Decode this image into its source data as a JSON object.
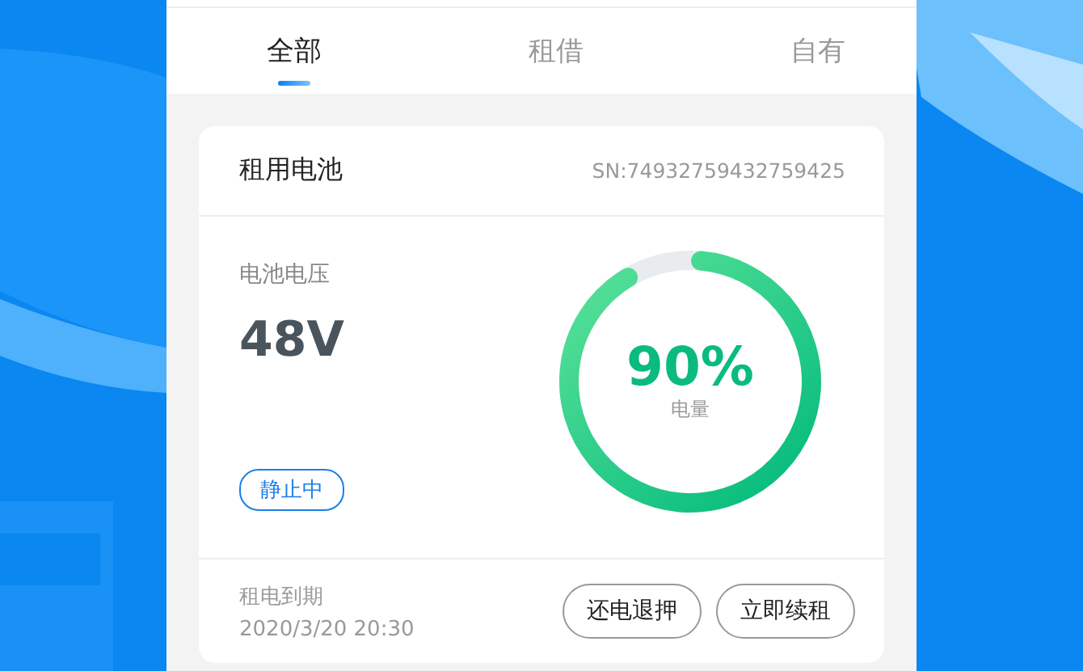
{
  "tabs": [
    {
      "label": "全部",
      "selected": true
    },
    {
      "label": "租借",
      "selected": false
    },
    {
      "label": "自有",
      "selected": false
    }
  ],
  "battery_card": {
    "title": "租用电池",
    "serial": "SN:74932759432759425",
    "voltage_label": "电池电压",
    "voltage": "48V",
    "status": "静止中",
    "charge": {
      "level": 0.9,
      "reading": "90%",
      "label": "电量"
    },
    "expiry_label": "租电到期",
    "expiry": "2020/3/20 20:30",
    "buttons": [
      "还电退押",
      "立即续租"
    ]
  }
}
